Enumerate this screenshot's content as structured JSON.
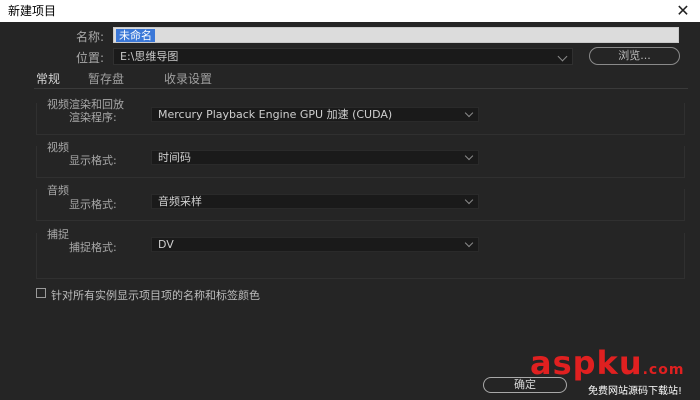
{
  "window": {
    "title": "新建项目",
    "close_icon": "close-icon"
  },
  "form": {
    "name_label": "名称:",
    "name_value": "未命名",
    "location_label": "位置:",
    "location_value": "E:\\思维导图",
    "browse_label": "浏览..."
  },
  "tabs": [
    {
      "label": "常规",
      "active": true
    },
    {
      "label": "暂存盘",
      "active": false
    },
    {
      "label": "收录设置",
      "active": false
    }
  ],
  "groups": {
    "render": {
      "title": "视频渲染和回放",
      "field_label": "渲染程序:",
      "value": "Mercury Playback Engine GPU 加速 (CUDA)"
    },
    "video": {
      "title": "视频",
      "field_label": "显示格式:",
      "value": "时间码"
    },
    "audio": {
      "title": "音频",
      "field_label": "显示格式:",
      "value": "音频采样"
    },
    "capture": {
      "title": "捕捉",
      "field_label": "捕捉格式:",
      "value": "DV"
    }
  },
  "checkbox": {
    "label": "针对所有实例显示项目项的名称和标签颜色",
    "checked": false
  },
  "footer": {
    "ok_label": "确定"
  },
  "watermark": {
    "brand_a": "asp",
    "brand_b": "ku",
    "brand_c": ".com",
    "tagline": "免费网站源码下载站!",
    "accent": "#e02020"
  }
}
